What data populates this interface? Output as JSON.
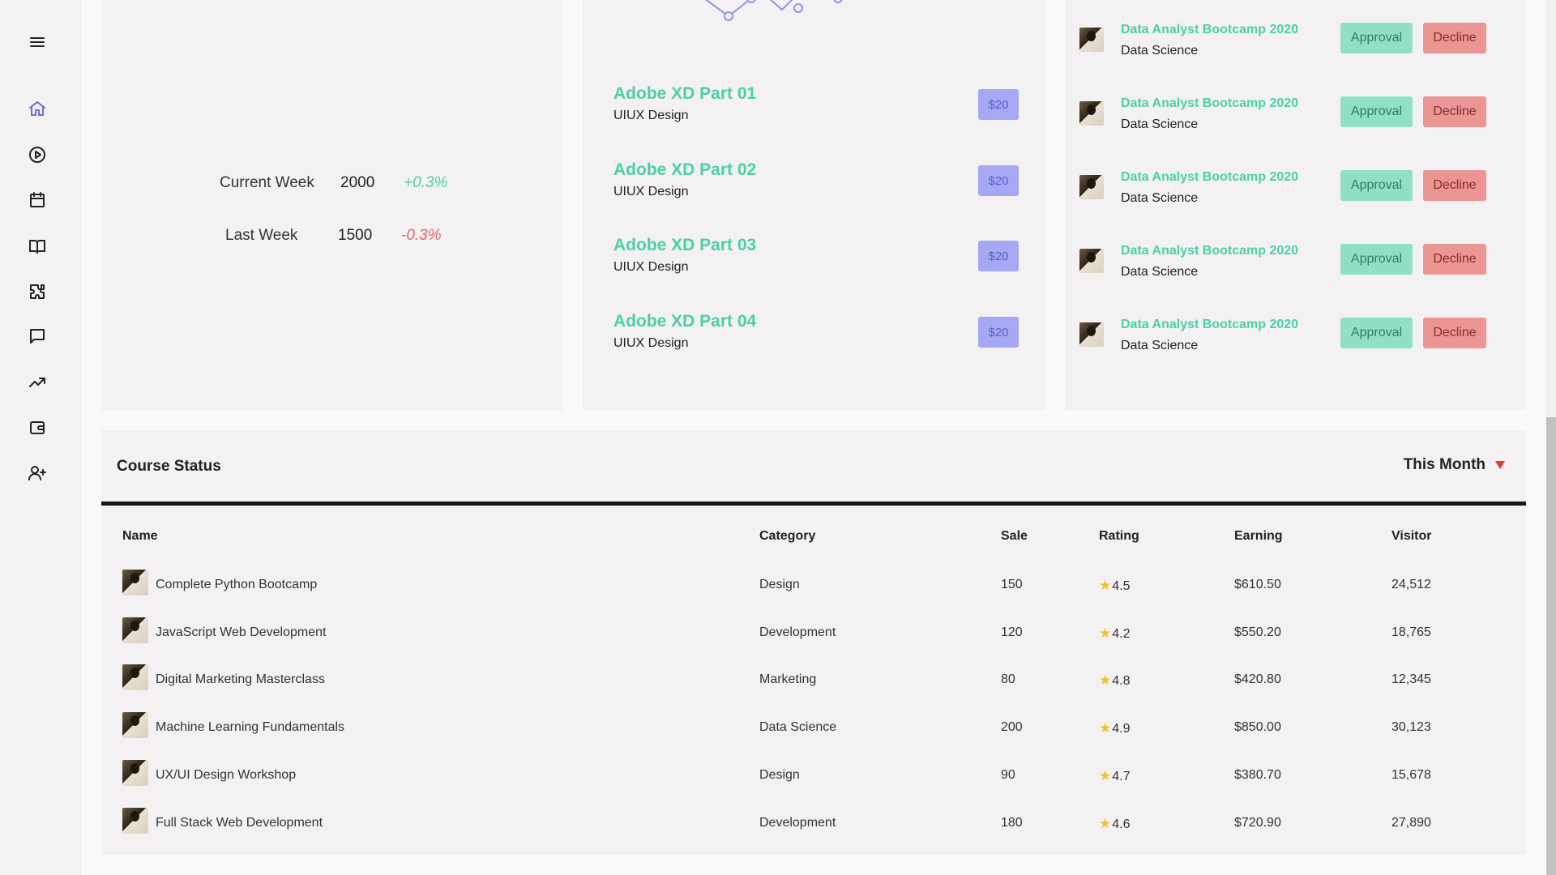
{
  "sidebar": {
    "icons": [
      "menu-icon",
      "home-icon",
      "play-icon",
      "calendar-icon",
      "book-icon",
      "puzzle-icon",
      "chat-icon",
      "trending-icon",
      "wallet-icon",
      "add-user-icon"
    ],
    "accent": "#6b6ce8"
  },
  "donut_card": {
    "progress_color": "#4ccfa9",
    "accent_color": "#6b6ce8",
    "stats": [
      {
        "label": "Current Week",
        "value": "2000",
        "change": "+0.3%"
      },
      {
        "label": "Last Week",
        "value": "1500",
        "change": "-0.3%"
      }
    ]
  },
  "courses_card": {
    "items": [
      {
        "title": "Adobe XD Part 01",
        "subtitle": "UIUX Design",
        "price": "$20"
      },
      {
        "title": "Adobe XD Part 02",
        "subtitle": "UIUX Design",
        "price": "$20"
      },
      {
        "title": "Adobe XD Part 03",
        "subtitle": "UIUX Design",
        "price": "$20"
      },
      {
        "title": "Adobe XD Part 04",
        "subtitle": "UIUX Design",
        "price": "$20"
      }
    ]
  },
  "approvals_card": {
    "approve_label": "Approval",
    "decline_label": "Decline",
    "items": [
      {
        "title": "Data Analyst Bootcamp 2020",
        "subtitle": "Data Science"
      },
      {
        "title": "Data Analyst Bootcamp 2020",
        "subtitle": "Data Science"
      },
      {
        "title": "Data Analyst Bootcamp 2020",
        "subtitle": "Data Science"
      },
      {
        "title": "Data Analyst Bootcamp 2020",
        "subtitle": "Data Science"
      },
      {
        "title": "Data Analyst Bootcamp 2020",
        "subtitle": "Data Science"
      }
    ]
  },
  "course_status": {
    "title": "Course Status",
    "period": "This Month",
    "columns": {
      "name": "Name",
      "category": "Category",
      "sale": "Sale",
      "rating": "Rating",
      "earning": "Earning",
      "visitor": "Visitor"
    },
    "rows": [
      {
        "name": "Complete Python Bootcamp",
        "category": "Design",
        "sale": "150",
        "rating": "4.5",
        "earning": "$610.50",
        "visitor": "24,512"
      },
      {
        "name": "JavaScript Web Development",
        "category": "Development",
        "sale": "120",
        "rating": "4.2",
        "earning": "$550.20",
        "visitor": "18,765"
      },
      {
        "name": "Digital Marketing Masterclass",
        "category": "Marketing",
        "sale": "80",
        "rating": "4.8",
        "earning": "$420.80",
        "visitor": "12,345"
      },
      {
        "name": "Machine Learning Fundamentals",
        "category": "Data Science",
        "sale": "200",
        "rating": "4.9",
        "earning": "$850.00",
        "visitor": "30,123"
      },
      {
        "name": "UX/UI Design Workshop",
        "category": "Design",
        "sale": "90",
        "rating": "4.7",
        "earning": "$380.70",
        "visitor": "15,678"
      },
      {
        "name": "Full Stack Web Development",
        "category": "Development",
        "sale": "180",
        "rating": "4.6",
        "earning": "$720.90",
        "visitor": "27,890"
      }
    ]
  }
}
